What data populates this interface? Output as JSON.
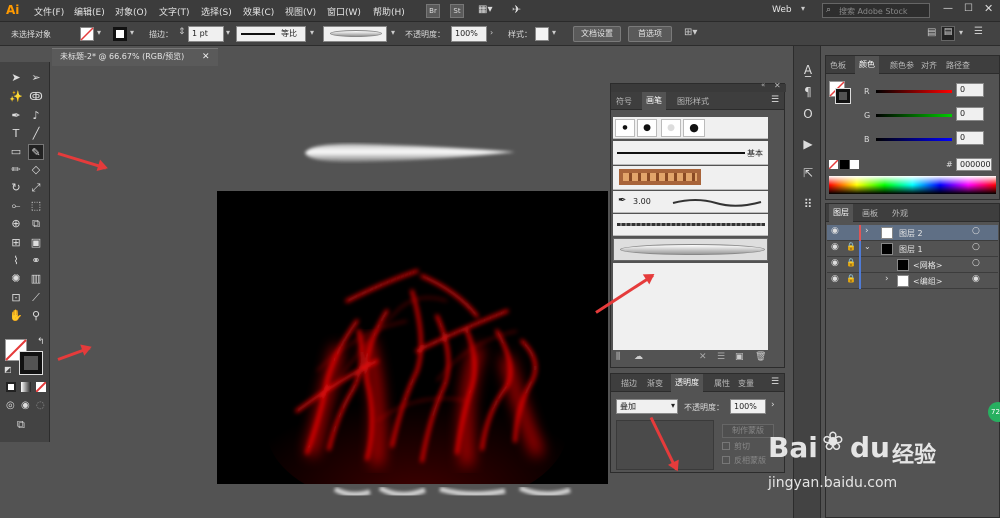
{
  "app": {
    "logo": "Ai"
  },
  "menu": [
    "文件(F)",
    "编辑(E)",
    "对象(O)",
    "文字(T)",
    "选择(S)",
    "效果(C)",
    "视图(V)",
    "窗口(W)",
    "帮助(H)"
  ],
  "bridge": [
    "Br",
    "St"
  ],
  "workspace": "Web",
  "search": {
    "placeholder": "搜索 Adobe Stock"
  },
  "control": {
    "selection": "未选择对象",
    "stroke_label": "描边：",
    "stroke_value": "1 pt",
    "profile": "等比",
    "opacity_label": "不透明度：",
    "opacity_value": "100%",
    "style_label": "样式：",
    "doc_setup": "文档设置",
    "prefs": "首选项"
  },
  "document": {
    "tab": "未标题-2* @ 66.67% (RGB/预览)"
  },
  "brushes_panel": {
    "tabs": [
      "符号",
      "画笔",
      "图形样式"
    ],
    "active_tab": "画笔",
    "basic_label": "基本",
    "calligraphic_size": "3.00"
  },
  "transparency_panel": {
    "tabs": [
      "描边",
      "渐变",
      "透明度",
      "属性",
      "变量"
    ],
    "active_tab": "透明度",
    "blend_mode": "叠加",
    "opacity_label": "不透明度：",
    "opacity_value": "100%",
    "make_mask": "制作蒙版",
    "clip": "剪切",
    "invert": "反相蒙版"
  },
  "color_panel": {
    "tabs": [
      "色板",
      "颜色",
      "颜色参",
      "对齐",
      "路径查"
    ],
    "active_tab": "颜色",
    "r_label": "R",
    "g_label": "G",
    "b_label": "B",
    "r": "0",
    "g": "0",
    "b": "0",
    "hex": "000000"
  },
  "layers_panel": {
    "tabs": [
      "图层",
      "画板",
      "外观"
    ],
    "active_tab": "图层",
    "layers": [
      {
        "name": "图层 2",
        "color": "#e05555"
      },
      {
        "name": "图层 1",
        "color": "#4f7bd6"
      },
      {
        "name": "<网格>",
        "color": "#4f7bd6"
      },
      {
        "name": "<编组>",
        "color": "#4f7bd6"
      }
    ]
  },
  "watermark": {
    "brand": "Bai",
    "brand2": "du",
    "cn": "经验",
    "url": "jingyan.baidu.com"
  },
  "badge": "72",
  "colors": {
    "accent_red": "#e53b3b",
    "app_bg": "#535353",
    "logo": "#ff9a00"
  }
}
